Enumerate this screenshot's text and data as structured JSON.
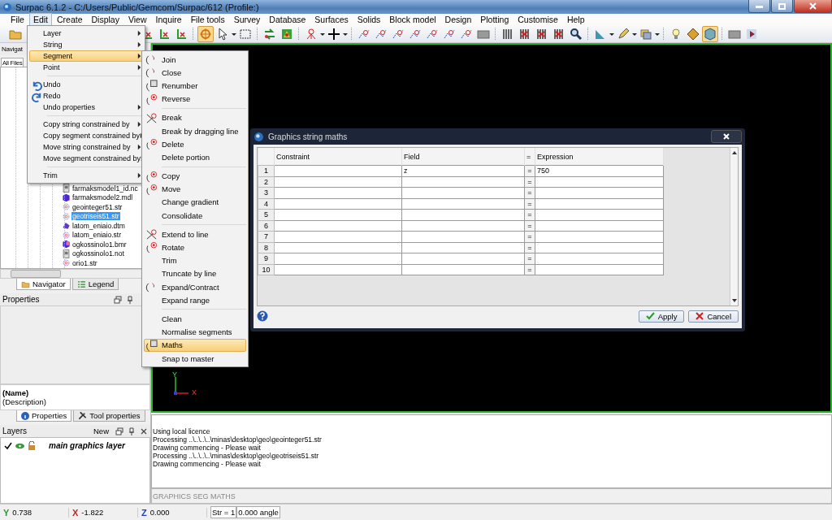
{
  "window": {
    "title": "Surpac 6.1.2 - C:/Users/Public/Gemcom/Surpac/612 (Profile:)"
  },
  "menu_bar": [
    {
      "label": "File",
      "selected": false
    },
    {
      "label": "Edit",
      "selected": true
    },
    {
      "label": "Create",
      "selected": false
    },
    {
      "label": "Display",
      "selected": false
    },
    {
      "label": "View",
      "selected": false
    },
    {
      "label": "Inquire",
      "selected": false
    },
    {
      "label": "File tools",
      "selected": false
    },
    {
      "label": "Survey",
      "selected": false
    },
    {
      "label": "Database",
      "selected": false
    },
    {
      "label": "Surfaces",
      "selected": false
    },
    {
      "label": "Solids",
      "selected": false
    },
    {
      "label": "Block model",
      "selected": false
    },
    {
      "label": "Design",
      "selected": false
    },
    {
      "label": "Plotting",
      "selected": false
    },
    {
      "label": "Customise",
      "selected": false
    },
    {
      "label": "Help",
      "selected": false
    }
  ],
  "toolbar": [
    {
      "kind": "folder",
      "selected": false
    },
    {
      "kind": "gap"
    },
    {
      "kind": "axis",
      "selected": false
    },
    {
      "kind": "axis",
      "selected": false
    },
    {
      "kind": "axis",
      "selected": false
    },
    {
      "kind": "separator"
    },
    {
      "kind": "target",
      "selected": true
    },
    {
      "kind": "cursor",
      "selected": false
    },
    {
      "kind": "caret"
    },
    {
      "kind": "select",
      "selected": false
    },
    {
      "kind": "separator"
    },
    {
      "kind": "arrows",
      "selected": false
    },
    {
      "kind": "terrain",
      "selected": false
    },
    {
      "kind": "separator"
    },
    {
      "kind": "node",
      "selected": false
    },
    {
      "kind": "caret"
    },
    {
      "kind": "plus",
      "selected": false
    },
    {
      "kind": "caret"
    },
    {
      "kind": "separator"
    },
    {
      "kind": "string",
      "selected": false
    },
    {
      "kind": "string",
      "selected": false
    },
    {
      "kind": "string",
      "selected": false
    },
    {
      "kind": "string",
      "selected": false
    },
    {
      "kind": "string",
      "selected": false
    },
    {
      "kind": "string",
      "selected": false
    },
    {
      "kind": "string",
      "selected": false
    },
    {
      "kind": "screen",
      "selected": false
    },
    {
      "kind": "separator"
    },
    {
      "kind": "bars",
      "selected": false
    },
    {
      "kind": "crossed",
      "selected": false
    },
    {
      "kind": "crossed",
      "selected": false
    },
    {
      "kind": "crossed",
      "selected": false
    },
    {
      "kind": "search",
      "selected": false
    },
    {
      "kind": "separator"
    },
    {
      "kind": "setsquare",
      "selected": false
    },
    {
      "kind": "caret"
    },
    {
      "kind": "pencil",
      "selected": false
    },
    {
      "kind": "caret"
    },
    {
      "kind": "layers",
      "selected": false
    },
    {
      "kind": "caret"
    },
    {
      "kind": "separator"
    },
    {
      "kind": "bulb",
      "selected": false
    },
    {
      "kind": "diamond",
      "selected": false
    },
    {
      "kind": "cube",
      "selected": true
    },
    {
      "kind": "separator"
    },
    {
      "kind": "screen",
      "selected": false
    },
    {
      "kind": "play",
      "selected": false
    }
  ],
  "edit_menu": [
    {
      "kind": "submenu",
      "label": "Layer",
      "selected": false
    },
    {
      "kind": "submenu",
      "label": "String",
      "selected": false
    },
    {
      "kind": "submenu",
      "label": "Segment",
      "selected": true
    },
    {
      "kind": "submenu",
      "label": "Point",
      "selected": false
    },
    {
      "kind": "separator"
    },
    {
      "kind": "undo",
      "label": "Undo",
      "selected": false
    },
    {
      "kind": "redo",
      "label": "Redo",
      "selected": false
    },
    {
      "kind": "submenu",
      "label": "Undo properties",
      "selected": false
    },
    {
      "kind": "separator"
    },
    {
      "kind": "submenu",
      "label": "Copy string constrained by",
      "selected": false
    },
    {
      "kind": "submenu",
      "label": "Copy segment constrained by",
      "selected": false
    },
    {
      "kind": "submenu",
      "label": "Move string constrained by",
      "selected": false
    },
    {
      "kind": "submenu",
      "label": "Move segment constrained by",
      "selected": false
    },
    {
      "kind": "separator"
    },
    {
      "kind": "submenu",
      "label": "Trim",
      "selected": false
    }
  ],
  "segment_menu": [
    {
      "kind": "arc",
      "label": "Join",
      "selected": false
    },
    {
      "kind": "arc",
      "label": "Close",
      "selected": false
    },
    {
      "kind": "box",
      "label": "Renumber",
      "selected": false
    },
    {
      "kind": "node",
      "label": "Reverse",
      "selected": false
    },
    {
      "kind": "separator"
    },
    {
      "kind": "cross",
      "label": "Break",
      "selected": false
    },
    {
      "kind": "plain",
      "label": "Break by dragging line",
      "selected": false
    },
    {
      "kind": "node",
      "label": "Delete",
      "selected": false
    },
    {
      "kind": "plain",
      "label": "Delete portion",
      "selected": false
    },
    {
      "kind": "separator"
    },
    {
      "kind": "node",
      "label": "Copy",
      "selected": false
    },
    {
      "kind": "node",
      "label": "Move",
      "selected": false
    },
    {
      "kind": "plain",
      "label": "Change gradient",
      "selected": false
    },
    {
      "kind": "plain",
      "label": "Consolidate",
      "selected": false
    },
    {
      "kind": "separator"
    },
    {
      "kind": "cross",
      "label": "Extend to line",
      "selected": false
    },
    {
      "kind": "node",
      "label": "Rotate",
      "selected": false
    },
    {
      "kind": "plain",
      "label": "Trim",
      "selected": false
    },
    {
      "kind": "plain",
      "label": "Truncate by line",
      "selected": false
    },
    {
      "kind": "arc",
      "label": "Expand/Contract",
      "selected": false
    },
    {
      "kind": "plain",
      "label": "Expand range",
      "selected": false
    },
    {
      "kind": "separator"
    },
    {
      "kind": "plain",
      "label": "Clean",
      "selected": false
    },
    {
      "kind": "plain",
      "label": "Normalise segments",
      "selected": false
    },
    {
      "kind": "box",
      "label": "Maths",
      "selected": true
    },
    {
      "kind": "plain",
      "label": "Snap to master",
      "selected": false
    }
  ],
  "navigator": {
    "title": "Navigat",
    "tab": "All Files",
    "files": [
      {
        "kind": "note",
        "name": "farmaksmodel1_id.nc",
        "selected": false
      },
      {
        "kind": "model",
        "name": "farmaksmodel2.mdl",
        "selected": false
      },
      {
        "kind": "string",
        "name": "geointeger51.str",
        "selected": false
      },
      {
        "kind": "string",
        "name": "geotriseis51.str",
        "selected": true
      },
      {
        "kind": "dtm",
        "name": "latom_eniaio.dtm",
        "selected": false
      },
      {
        "kind": "string",
        "name": "latom_eniaio.str",
        "selected": false
      },
      {
        "kind": "block",
        "name": "ogkossinolo1.bmr",
        "selected": false
      },
      {
        "kind": "note",
        "name": "ogkossinolo1.not",
        "selected": false
      },
      {
        "kind": "string",
        "name": "orio1.str",
        "selected": false
      }
    ],
    "tabs": [
      {
        "label": "Navigator",
        "selected": true
      },
      {
        "label": "Legend",
        "selected": false
      }
    ]
  },
  "properties": {
    "title": "Properties",
    "name": "(Name)",
    "description": "(Description)",
    "tabs": [
      {
        "label": "Properties",
        "selected": true
      },
      {
        "label": "Tool properties",
        "selected": false
      }
    ]
  },
  "layers": {
    "title": "Layers",
    "new_button": "New",
    "items": [
      {
        "label": "main graphics layer",
        "checked": true
      }
    ]
  },
  "viewport": {
    "axis_labels": [
      "Y",
      "X"
    ]
  },
  "messages": [
    "Using local licence",
    "Processing ..\\..\\..\\..\\minas\\desktop\\geo\\geointeger51.str",
    "Drawing commencing - Please wait",
    "Processing ..\\..\\..\\..\\minas\\desktop\\geo\\geotriseis51.str",
    "Drawing commencing - Please wait"
  ],
  "command_line": "GRAPHICS SEG MATHS",
  "status_bar": {
    "coordinates": [
      {
        "label": "Y",
        "value": "0.738",
        "color": "#2a9a2a"
      },
      {
        "label": "X",
        "value": "-1.822",
        "color": "#d02020"
      },
      {
        "label": "Z",
        "value": "0.000",
        "color": "#2040c0"
      }
    ],
    "string": "Str = 1",
    "angle": "0.000 angle"
  },
  "dialog": {
    "title": "Graphics string maths",
    "columns": [
      "Constraint",
      "Field",
      "=",
      "Expression"
    ],
    "rows": [
      {
        "number": "1",
        "field": "z",
        "operator": "=",
        "expression": "750"
      },
      {
        "number": "2",
        "operator": "="
      },
      {
        "number": "3",
        "operator": "="
      },
      {
        "number": "4",
        "operator": "="
      },
      {
        "number": "5",
        "operator": "="
      },
      {
        "number": "6",
        "operator": "="
      },
      {
        "number": "7",
        "operator": "="
      },
      {
        "number": "8",
        "operator": "="
      },
      {
        "number": "9",
        "operator": "="
      },
      {
        "number": "10",
        "operator": "="
      }
    ],
    "buttons": [
      {
        "kind": "apply",
        "label": "Apply"
      },
      {
        "kind": "cancel",
        "label": "Cancel"
      }
    ]
  }
}
